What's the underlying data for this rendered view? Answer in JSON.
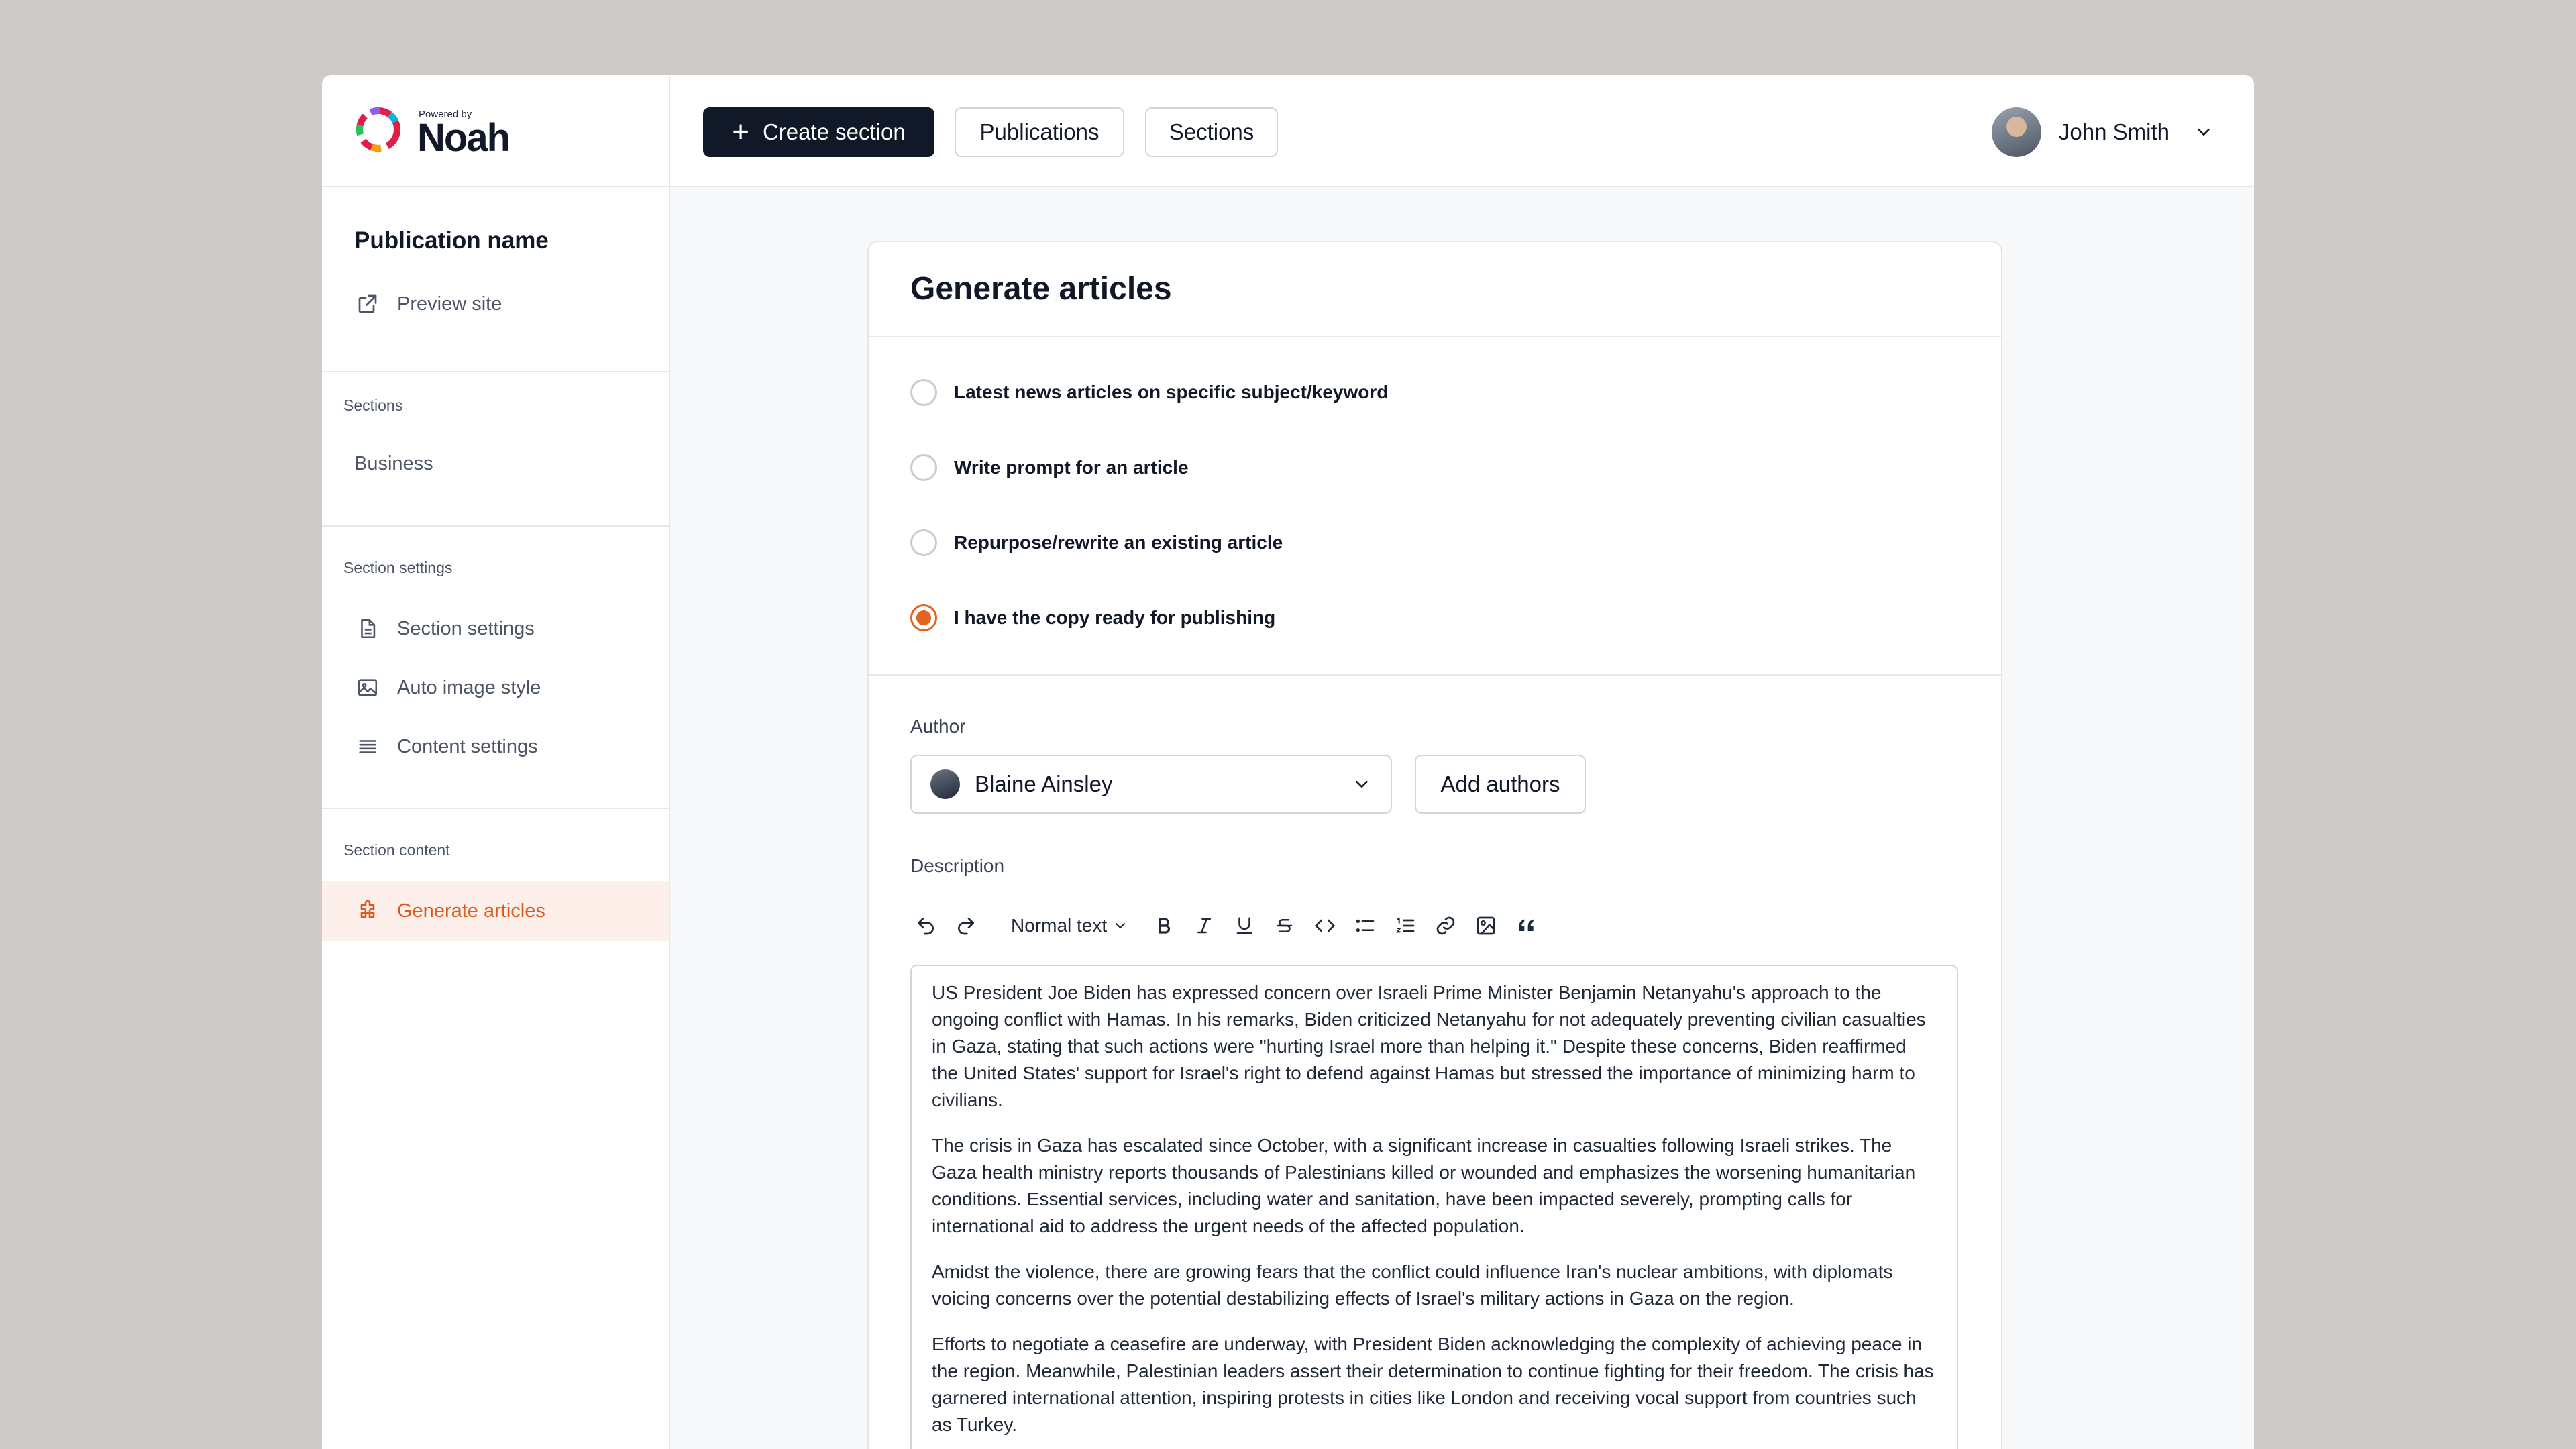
{
  "brand": {
    "powered_by": "Powered by",
    "name": "Noah"
  },
  "header": {
    "create_section": "Create section",
    "publications": "Publications",
    "sections": "Sections",
    "user_name": "John Smith"
  },
  "sidebar": {
    "publication_name": "Publication name",
    "preview_site": "Preview site",
    "sections_label": "Sections",
    "sections_items": [
      "Business"
    ],
    "section_settings_label": "Section settings",
    "settings_items": [
      "Section settings",
      "Auto image style",
      "Content settings"
    ],
    "section_content_label": "Section content",
    "content_items": [
      "Generate articles"
    ]
  },
  "card": {
    "title": "Generate articles",
    "options": [
      {
        "label": "Latest news articles on specific subject/keyword",
        "selected": false
      },
      {
        "label": "Write prompt for an article",
        "selected": false
      },
      {
        "label": "Repurpose/rewrite an existing article",
        "selected": false
      },
      {
        "label": "I have the copy ready for publishing",
        "selected": true
      }
    ],
    "author_label": "Author",
    "author_value": "Blaine Ainsley",
    "add_authors": "Add authors",
    "description_label": "Description",
    "text_style": "Normal text",
    "paragraphs": [
      "US President Joe Biden has expressed concern over Israeli Prime Minister Benjamin Netanyahu's approach to the ongoing conflict with Hamas. In his remarks, Biden criticized Netanyahu for not adequately preventing civilian casualties in Gaza, stating that such actions were \"hurting Israel more than helping it.\" Despite these concerns, Biden reaffirmed the United States' support for Israel's right to defend against Hamas but stressed the importance of minimizing harm to civilians.",
      "The crisis in Gaza has escalated since October, with a significant increase in casualties following Israeli strikes. The Gaza health ministry reports thousands of Palestinians killed or wounded and emphasizes the worsening humanitarian conditions. Essential services, including water and sanitation, have been impacted severely, prompting calls for international aid to address the urgent needs of the affected population.",
      "Amidst the violence, there are growing fears that the conflict could influence Iran's nuclear ambitions, with diplomats voicing concerns over the potential destabilizing effects of Israel's military actions in Gaza on the region.",
      "Efforts to negotiate a ceasefire are underway, with President Biden acknowledging the complexity of achieving peace in the region. Meanwhile, Palestinian leaders assert their determination to continue fighting for their freedom. The crisis has garnered international attention, inspiring protests in cities like London and receiving vocal support from countries such as Turkey."
    ]
  },
  "colors": {
    "accent": "#e0641f",
    "primary": "#111827",
    "active_bg": "#fdf0ea"
  }
}
